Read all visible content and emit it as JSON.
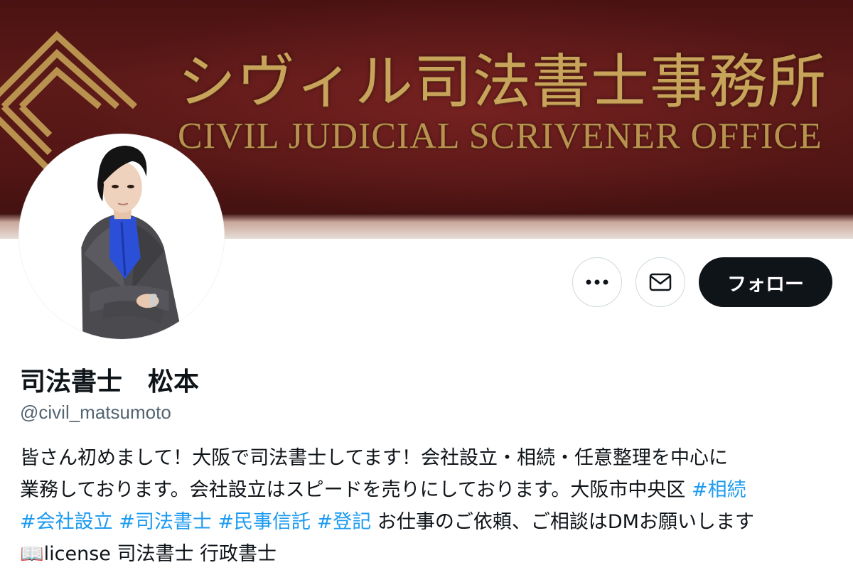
{
  "banner": {
    "title_jp": "シヴィル司法書士事務所",
    "title_en": "CIVIL JUDICIAL SCRIVENER OFFICE"
  },
  "actions": {
    "more_icon": "ellipsis-icon",
    "message_icon": "mail-icon",
    "follow_label": "フォロー"
  },
  "profile": {
    "display_name": "司法書士　松本",
    "handle": "@civil_matsumoto",
    "bio": {
      "line1": "皆さん初めまして！大阪で司法書士してます！会社設立・相続・任意整理を中心に",
      "line2_text": "業務しております。会社設立はスピードを売りにしております。大阪市中央区 ",
      "line2_tag": "#相続",
      "line3_tags": [
        "#会社設立",
        "#司法書士",
        "#民事信託",
        "#登記"
      ],
      "line3_text": " お仕事のご依頼、ご相談はDMお願いします",
      "line4_emoji": "📖",
      "line4_text": "license 司法書士 行政書士"
    }
  },
  "colors": {
    "accent": "#1d9bf0",
    "text": "#0f1419",
    "secondary": "#536471",
    "follow_bg": "#0f1419",
    "banner": "#521614",
    "gold": "#c8a45a"
  }
}
